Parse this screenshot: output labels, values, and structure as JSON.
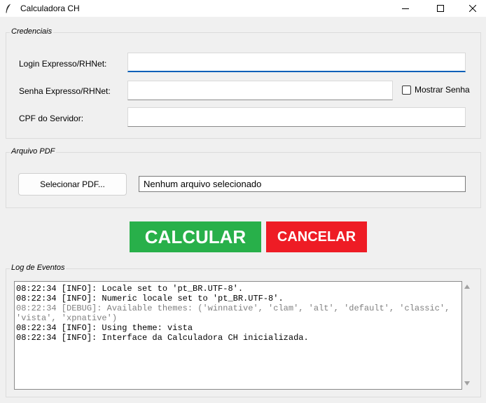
{
  "window": {
    "title": "Calculadora CH",
    "app_icon": "feather-icon",
    "controls": [
      "minimize-icon",
      "maximize-icon",
      "close-icon"
    ]
  },
  "credenciais": {
    "group_label": "Credenciais",
    "login_label": "Login Expresso/RHNet:",
    "login_value": "",
    "senha_label": "Senha Expresso/RHNet:",
    "senha_value": "",
    "mostrar_senha_label": "Mostrar Senha",
    "mostrar_senha_checked": false,
    "cpf_label": "CPF do Servidor:",
    "cpf_value": ""
  },
  "arquivo": {
    "group_label": "Arquivo PDF",
    "select_button": "Selecionar PDF...",
    "file_status": "Nenhum arquivo selecionado"
  },
  "actions": {
    "calcular": "CALCULAR",
    "cancelar": "CANCELAR",
    "calcular_color": "#28b04a",
    "cancelar_color": "#ee1c25"
  },
  "log": {
    "group_label": "Log de Eventos",
    "lines": [
      {
        "level": "info",
        "text": "08:22:34 [INFO]: Locale set to 'pt_BR.UTF-8'."
      },
      {
        "level": "info",
        "text": "08:22:34 [INFO]: Numeric locale set to 'pt_BR.UTF-8'."
      },
      {
        "level": "debug",
        "text": "08:22:34 [DEBUG]: Available themes: ('winnative', 'clam', 'alt', 'default', 'classic', 'vista', 'xpnative')"
      },
      {
        "level": "info",
        "text": "08:22:34 [INFO]: Using theme: vista"
      },
      {
        "level": "info",
        "text": "08:22:34 [INFO]: Interface da Calculadora CH inicializada."
      }
    ]
  }
}
